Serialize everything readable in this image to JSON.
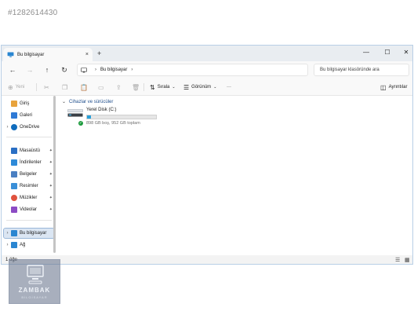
{
  "listing_id": "#1282614430",
  "window": {
    "tab_title": "Bu bilgisayar",
    "tab_close": "×",
    "new_tab": "+",
    "minimize": "—",
    "maximize": "☐",
    "close": "✕"
  },
  "addressbar": {
    "back": "←",
    "forward": "→",
    "up": "↑",
    "refresh": "↻",
    "breadcrumb": [
      "Bu bilgisayar"
    ],
    "breadcrumb_sep": "›",
    "search_placeholder": "Bu bilgisayar klasöründe ara"
  },
  "commandbar": {
    "new_label": "Yeni",
    "sort_label": "Sırala",
    "view_label": "Görünüm",
    "more_label": "···",
    "details_label": "Ayrıntılar"
  },
  "navigation": {
    "items": [
      {
        "label": "Giriş",
        "icon": "home-icon",
        "color": "#e8a33c"
      },
      {
        "label": "Galeri",
        "icon": "gallery-icon",
        "color": "#2f7ad6"
      },
      {
        "label": "OneDrive",
        "icon": "cloud-icon",
        "color": "#0f6cbd"
      },
      {
        "label": "Masaüstü",
        "icon": "desktop-icon",
        "color": "#2a6fc4"
      },
      {
        "label": "İndirilenler",
        "icon": "download-icon",
        "color": "#2e8ad8"
      },
      {
        "label": "Belgeler",
        "icon": "documents-icon",
        "color": "#4a7fc2"
      },
      {
        "label": "Resimler",
        "icon": "pictures-icon",
        "color": "#3a8fd8"
      },
      {
        "label": "Müzikler",
        "icon": "music-icon",
        "color": "#e0523e"
      },
      {
        "label": "Videolar",
        "icon": "videos-icon",
        "color": "#8c4bc4"
      },
      {
        "label": "Bu bilgisayar",
        "icon": "computer-icon",
        "color": "#2a86d1"
      },
      {
        "label": "Ağ",
        "icon": "network-icon",
        "color": "#2a86d1"
      }
    ],
    "pin_glyph": "📌"
  },
  "main": {
    "group_title": "Cihazlar ve sürücüler",
    "drive": {
      "name": "Yerel Disk (C:)",
      "used_fraction": 0.06,
      "space_text": "898 GB boş, 952 GB toplam"
    }
  },
  "statusbar": {
    "item_count": "1 öğe"
  },
  "watermark": {
    "brand": "ZAMBAK",
    "sub": "BİLGİSAYAR"
  },
  "colors": {
    "accent": "#26a0da",
    "selection": "#dbe6f3",
    "group_title": "#1f4e8c"
  }
}
